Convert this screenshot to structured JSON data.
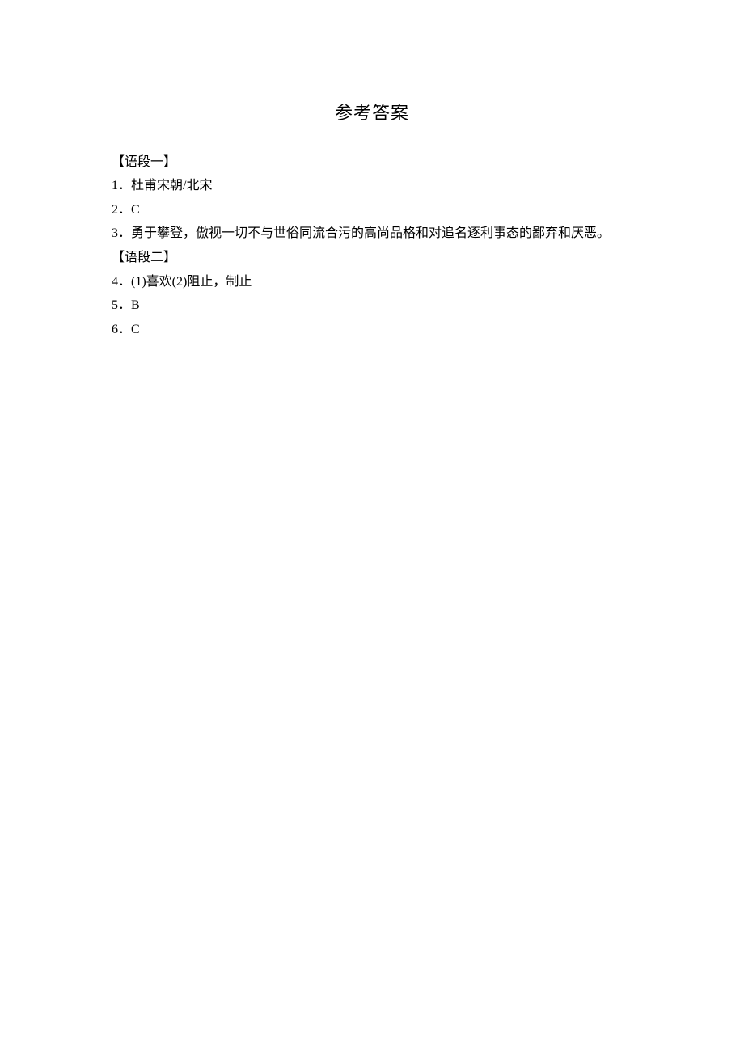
{
  "title": "参考答案",
  "sections": [
    {
      "header": "【语段一】",
      "items": [
        "1．杜甫宋朝/北宋",
        "2．C",
        "3．勇于攀登，傲视一切不与世俗同流合污的高尚品格和对追名逐利事态的鄙弃和厌恶。"
      ]
    },
    {
      "header": "【语段二】",
      "items": [
        "4．(1)喜欢(2)阻止，制止",
        "5．B",
        "6．C"
      ]
    }
  ]
}
